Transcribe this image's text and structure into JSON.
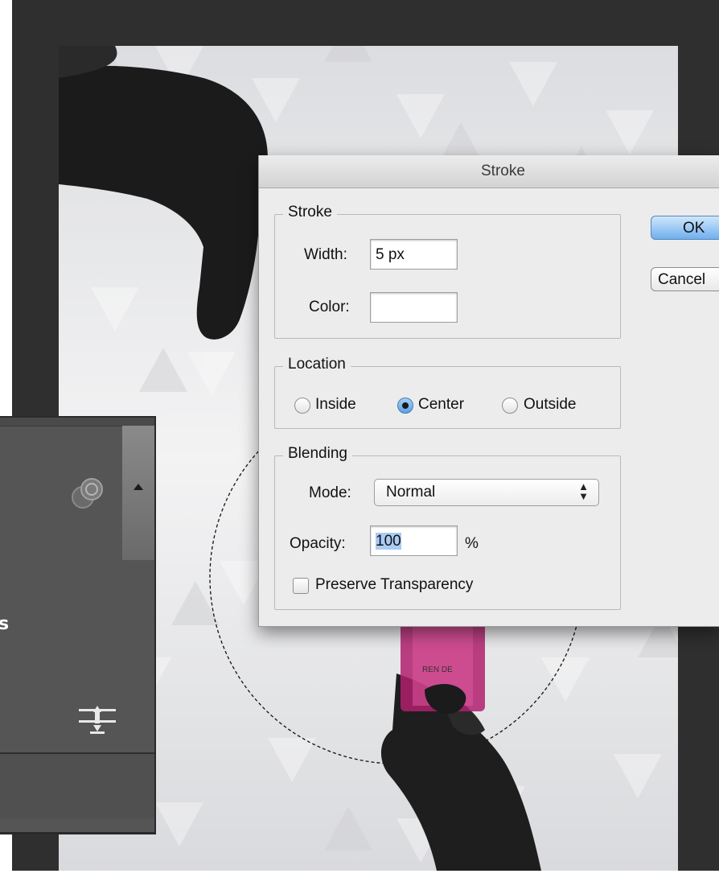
{
  "dialog": {
    "title": "Stroke",
    "stroke_group": {
      "legend": "Stroke",
      "width_label": "Width:",
      "width_value": "5 px",
      "color_label": "Color:",
      "color_value": "#ffffff"
    },
    "location_group": {
      "legend": "Location",
      "options": [
        {
          "label": "Inside",
          "selected": false
        },
        {
          "label": "Center",
          "selected": true
        },
        {
          "label": "Outside",
          "selected": false
        }
      ]
    },
    "blending_group": {
      "legend": "Blending",
      "mode_label": "Mode:",
      "mode_value": "Normal",
      "opacity_label": "Opacity:",
      "opacity_value": "100",
      "opacity_unit": "%",
      "preserve_label": "Preserve Transparency",
      "preserve_checked": false
    },
    "buttons": {
      "ok": "OK",
      "cancel": "Cancel"
    }
  },
  "side_panel": {
    "partial_text": "s",
    "icons": [
      "layer-circles-icon",
      "scroll-up-arrow-icon",
      "distribute-align-icon"
    ]
  },
  "canvas": {
    "bottle_label": "REN DE",
    "selection": "circular-marquee"
  },
  "colors": {
    "app_background": "#2f2f2f",
    "dialog_background": "#ececec",
    "default_button": "#6fb0ee",
    "bottle_magenta": "#b0206e"
  }
}
